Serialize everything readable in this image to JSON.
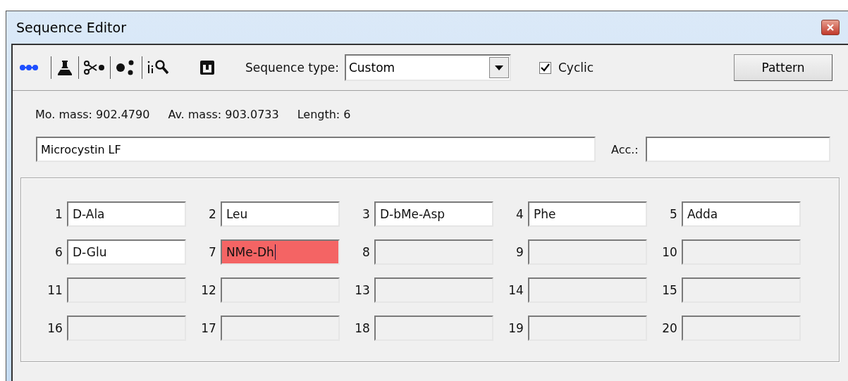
{
  "window": {
    "title": "Sequence Editor"
  },
  "toolbar": {
    "sequence_type_label": "Sequence type:",
    "sequence_type": "Custom",
    "cyclic": {
      "label": "Cyclic",
      "checked": true
    },
    "pattern_button": "Pattern"
  },
  "info": {
    "mono_mass": "Mo. mass: 902.4790",
    "avg_mass": "Av. mass: 903.0733",
    "length": "Length: 6"
  },
  "name_field": {
    "value": "Microcystin LF"
  },
  "accession": {
    "label": "Acc.:"
  },
  "residues": [
    {
      "number": "1",
      "value": "D-Ala",
      "disabled": false,
      "invalid": false
    },
    {
      "number": "2",
      "value": "Leu",
      "disabled": false,
      "invalid": false
    },
    {
      "number": "3",
      "value": "D-bMe-Asp",
      "disabled": false,
      "invalid": false
    },
    {
      "number": "4",
      "value": "Phe",
      "disabled": false,
      "invalid": false
    },
    {
      "number": "5",
      "value": "Adda",
      "disabled": false,
      "invalid": false
    },
    {
      "number": "6",
      "value": "D-Glu",
      "disabled": false,
      "invalid": false
    },
    {
      "number": "7",
      "value": "NMe-Dh",
      "disabled": false,
      "invalid": true
    },
    {
      "number": "8",
      "disabled": true,
      "invalid": false
    },
    {
      "number": "9",
      "disabled": true,
      "invalid": false
    },
    {
      "number": "10",
      "disabled": true,
      "invalid": false
    },
    {
      "number": "11",
      "disabled": true,
      "invalid": false
    },
    {
      "number": "12",
      "disabled": true,
      "invalid": false
    },
    {
      "number": "13",
      "disabled": true,
      "invalid": false
    },
    {
      "number": "14",
      "disabled": true,
      "invalid": false
    },
    {
      "number": "15",
      "disabled": true,
      "invalid": false
    },
    {
      "number": "16",
      "disabled": true,
      "invalid": false
    },
    {
      "number": "17",
      "disabled": true,
      "invalid": false
    },
    {
      "number": "18",
      "disabled": true,
      "invalid": false
    },
    {
      "number": "19",
      "disabled": true,
      "invalid": false
    },
    {
      "number": "20",
      "disabled": true,
      "invalid": false
    }
  ]
}
